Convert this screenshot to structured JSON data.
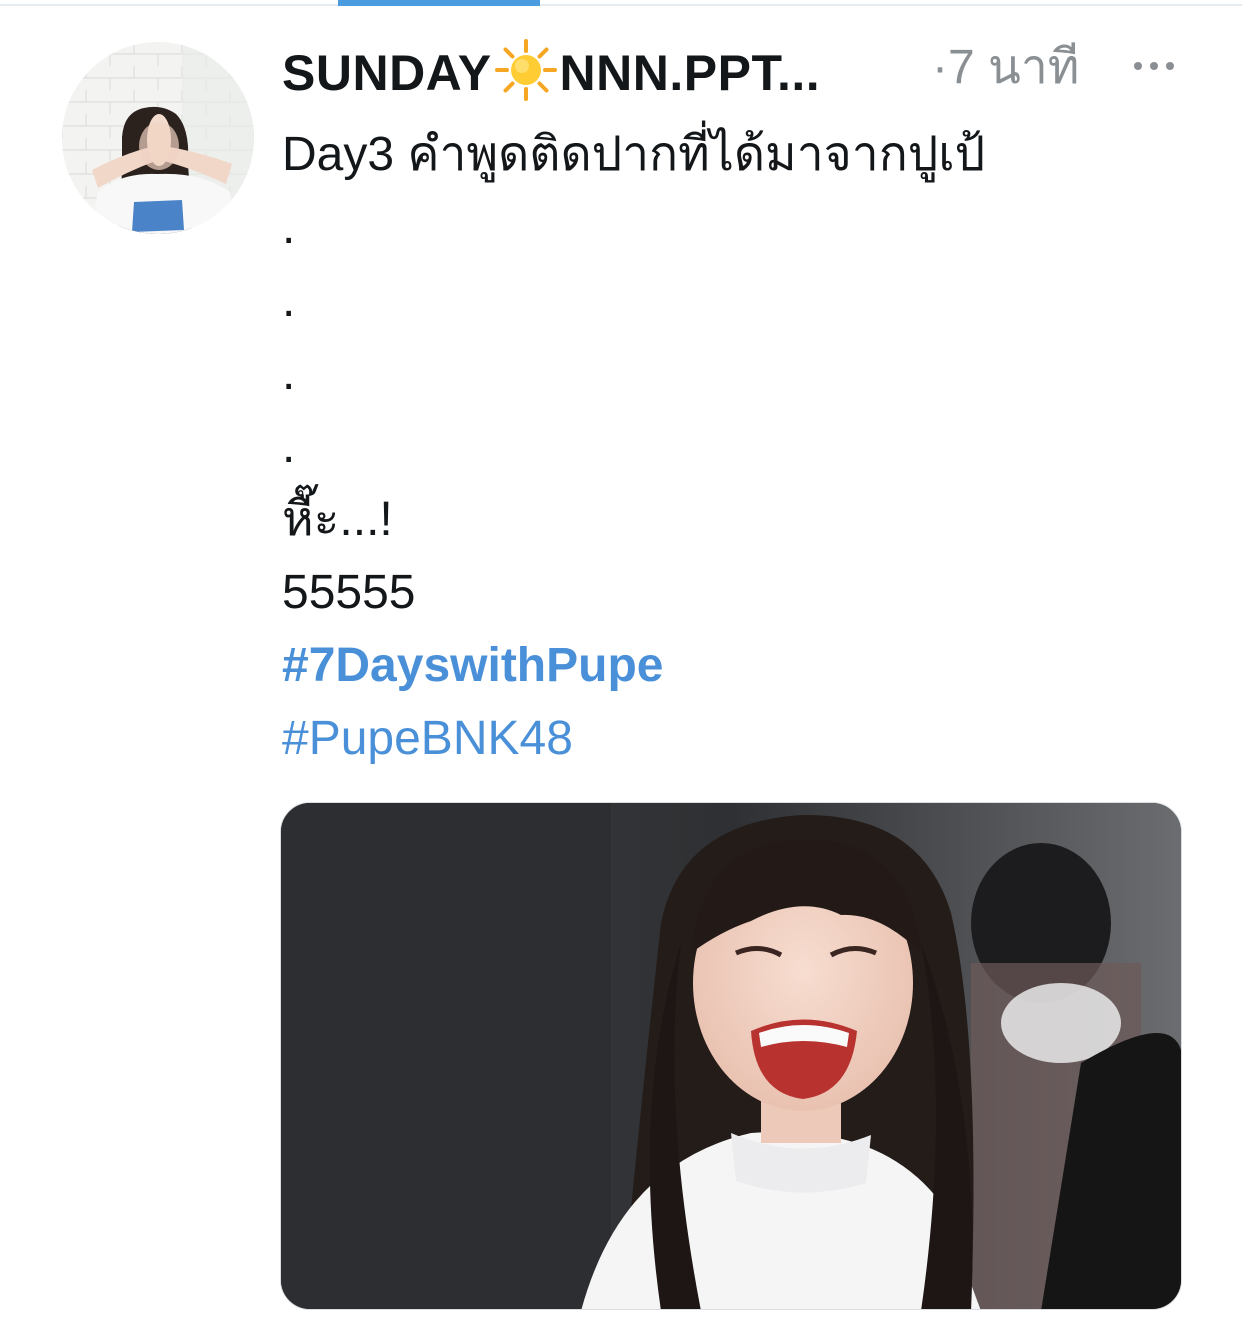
{
  "tweet": {
    "display_name_part1": "SUNDAY",
    "display_name_part2": "NNN.PPT...",
    "display_name_emoji": "sun-emoji",
    "timestamp": "·7 นาที",
    "lines": [
      "Day3 คำพูดติดปากที่ได้มาจากปูเป้",
      ".",
      ".",
      ".",
      ".",
      "หื๊ะ...!",
      "55555"
    ],
    "hashtags": [
      "#7DayswithPupe",
      "#PupeBNK48"
    ]
  },
  "colors": {
    "hashtag": "#4a90d9",
    "timestamp": "#8a8f94",
    "accent": "#4a9be0"
  },
  "icons": [
    "sun-icon",
    "more-icon"
  ]
}
